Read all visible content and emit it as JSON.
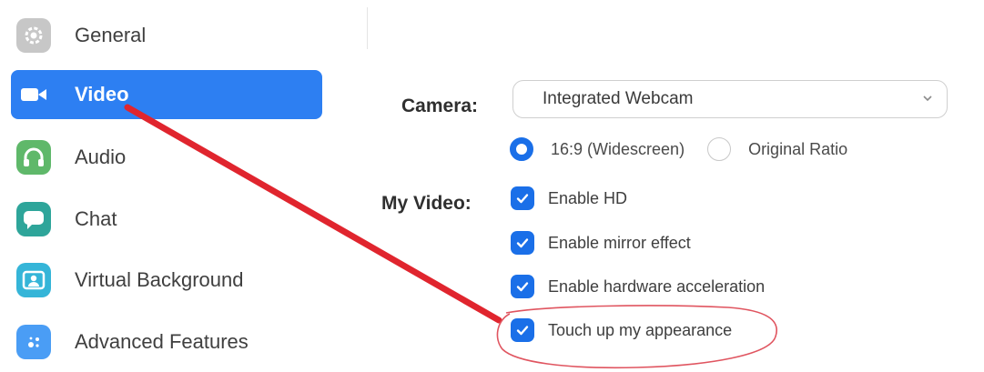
{
  "sidebar": {
    "items": [
      {
        "label": "General",
        "icon": "gear-icon",
        "color": "#c7c7c7",
        "active": false
      },
      {
        "label": "Video",
        "icon": "video-camera-icon",
        "color": "#2d7ff2",
        "active": true
      },
      {
        "label": "Audio",
        "icon": "headphones-icon",
        "color": "#5fb86a",
        "active": false
      },
      {
        "label": "Chat",
        "icon": "chat-bubble-icon",
        "color": "#2ea59a",
        "active": false
      },
      {
        "label": "Virtual Background",
        "icon": "virtual-background-icon",
        "color": "#35b5d8",
        "active": false
      },
      {
        "label": "Advanced Features",
        "icon": "advanced-features-icon",
        "color": "#4a9df5",
        "active": false
      }
    ]
  },
  "video": {
    "camera_label": "Camera:",
    "camera_value": "Integrated Webcam",
    "ratio_options": [
      {
        "label": "16:9 (Widescreen)",
        "selected": true
      },
      {
        "label": "Original Ratio",
        "selected": false
      }
    ],
    "my_video_label": "My Video:",
    "options": [
      {
        "label": "Enable HD",
        "checked": true
      },
      {
        "label": "Enable mirror effect",
        "checked": true
      },
      {
        "label": "Enable hardware acceleration",
        "checked": true
      },
      {
        "label": "Touch up my appearance",
        "checked": true
      }
    ]
  },
  "colors": {
    "accent": "#2d7ff2",
    "checkbox": "#1a6fe8",
    "annotation_arrow": "#e0252e",
    "annotation_circle": "#e05560"
  }
}
